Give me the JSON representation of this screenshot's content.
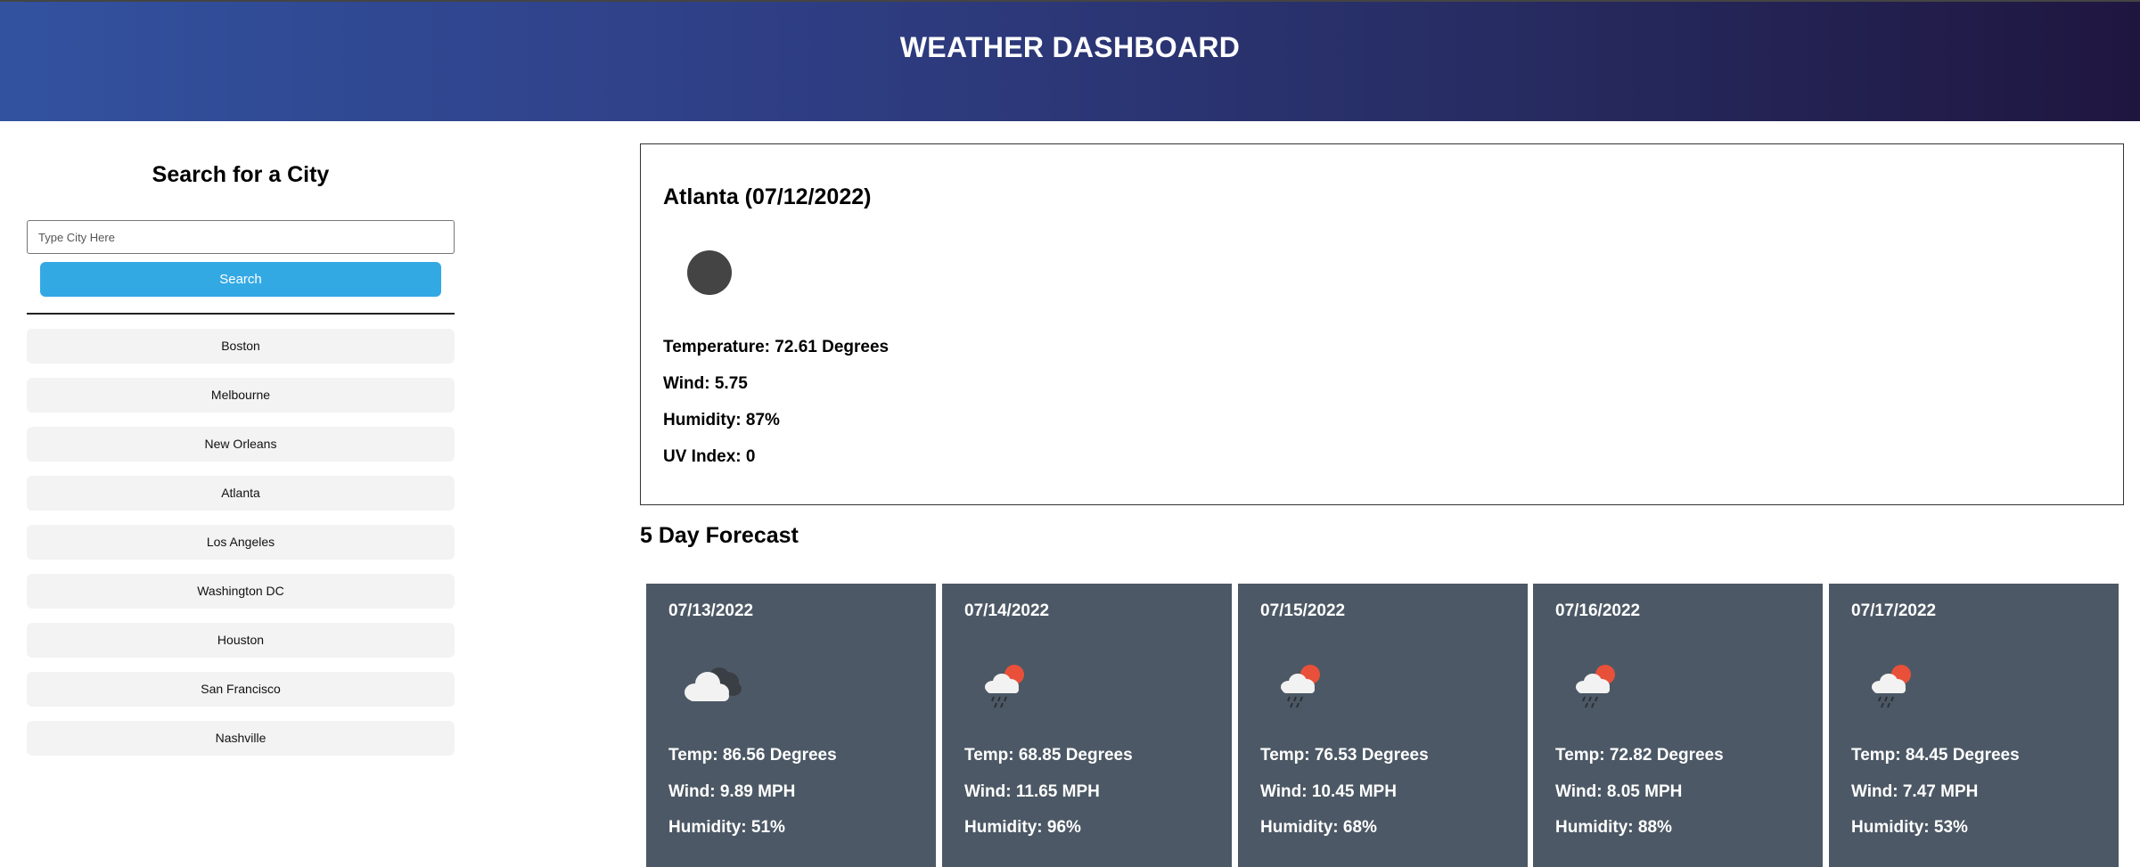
{
  "header": {
    "title": "WEATHER DASHBOARD"
  },
  "sidebar": {
    "heading": "Search for a City",
    "search_placeholder": "Type City Here",
    "search_button": "Search",
    "history": [
      "Boston",
      "Melbourne",
      "New Orleans",
      "Atlanta",
      "Los Angeles",
      "Washington DC",
      "Houston",
      "San Francisco",
      "Nashville"
    ]
  },
  "current": {
    "title": "Atlanta (07/12/2022)",
    "icon": "dark-circle-icon",
    "temperature": "Temperature: 72.61 Degrees",
    "wind": "Wind: 5.75",
    "humidity": "Humidity: 87%",
    "uv": "UV Index: 0"
  },
  "forecast": {
    "title": "5 Day Forecast",
    "days": [
      {
        "date": "07/13/2022",
        "icon": "cloudy-icon",
        "temp": "Temp: 86.56 Degrees",
        "wind": "Wind: 9.89 MPH",
        "humidity": "Humidity: 51%"
      },
      {
        "date": "07/14/2022",
        "icon": "rain-sun-icon",
        "temp": "Temp: 68.85 Degrees",
        "wind": "Wind: 11.65 MPH",
        "humidity": "Humidity: 96%"
      },
      {
        "date": "07/15/2022",
        "icon": "rain-sun-icon",
        "temp": "Temp: 76.53 Degrees",
        "wind": "Wind: 10.45 MPH",
        "humidity": "Humidity: 68%"
      },
      {
        "date": "07/16/2022",
        "icon": "rain-sun-icon",
        "temp": "Temp: 72.82 Degrees",
        "wind": "Wind: 8.05 MPH",
        "humidity": "Humidity: 88%"
      },
      {
        "date": "07/17/2022",
        "icon": "rain-sun-icon",
        "temp": "Temp: 84.45 Degrees",
        "wind": "Wind: 7.47 MPH",
        "humidity": "Humidity: 53%"
      }
    ]
  },
  "colors": {
    "header_start": "#32529f",
    "header_end": "#1f1640",
    "search_button": "#33a9e4",
    "history_bg": "#f3f3f3",
    "card_bg": "#4c5865",
    "sun": "#e8503a"
  }
}
